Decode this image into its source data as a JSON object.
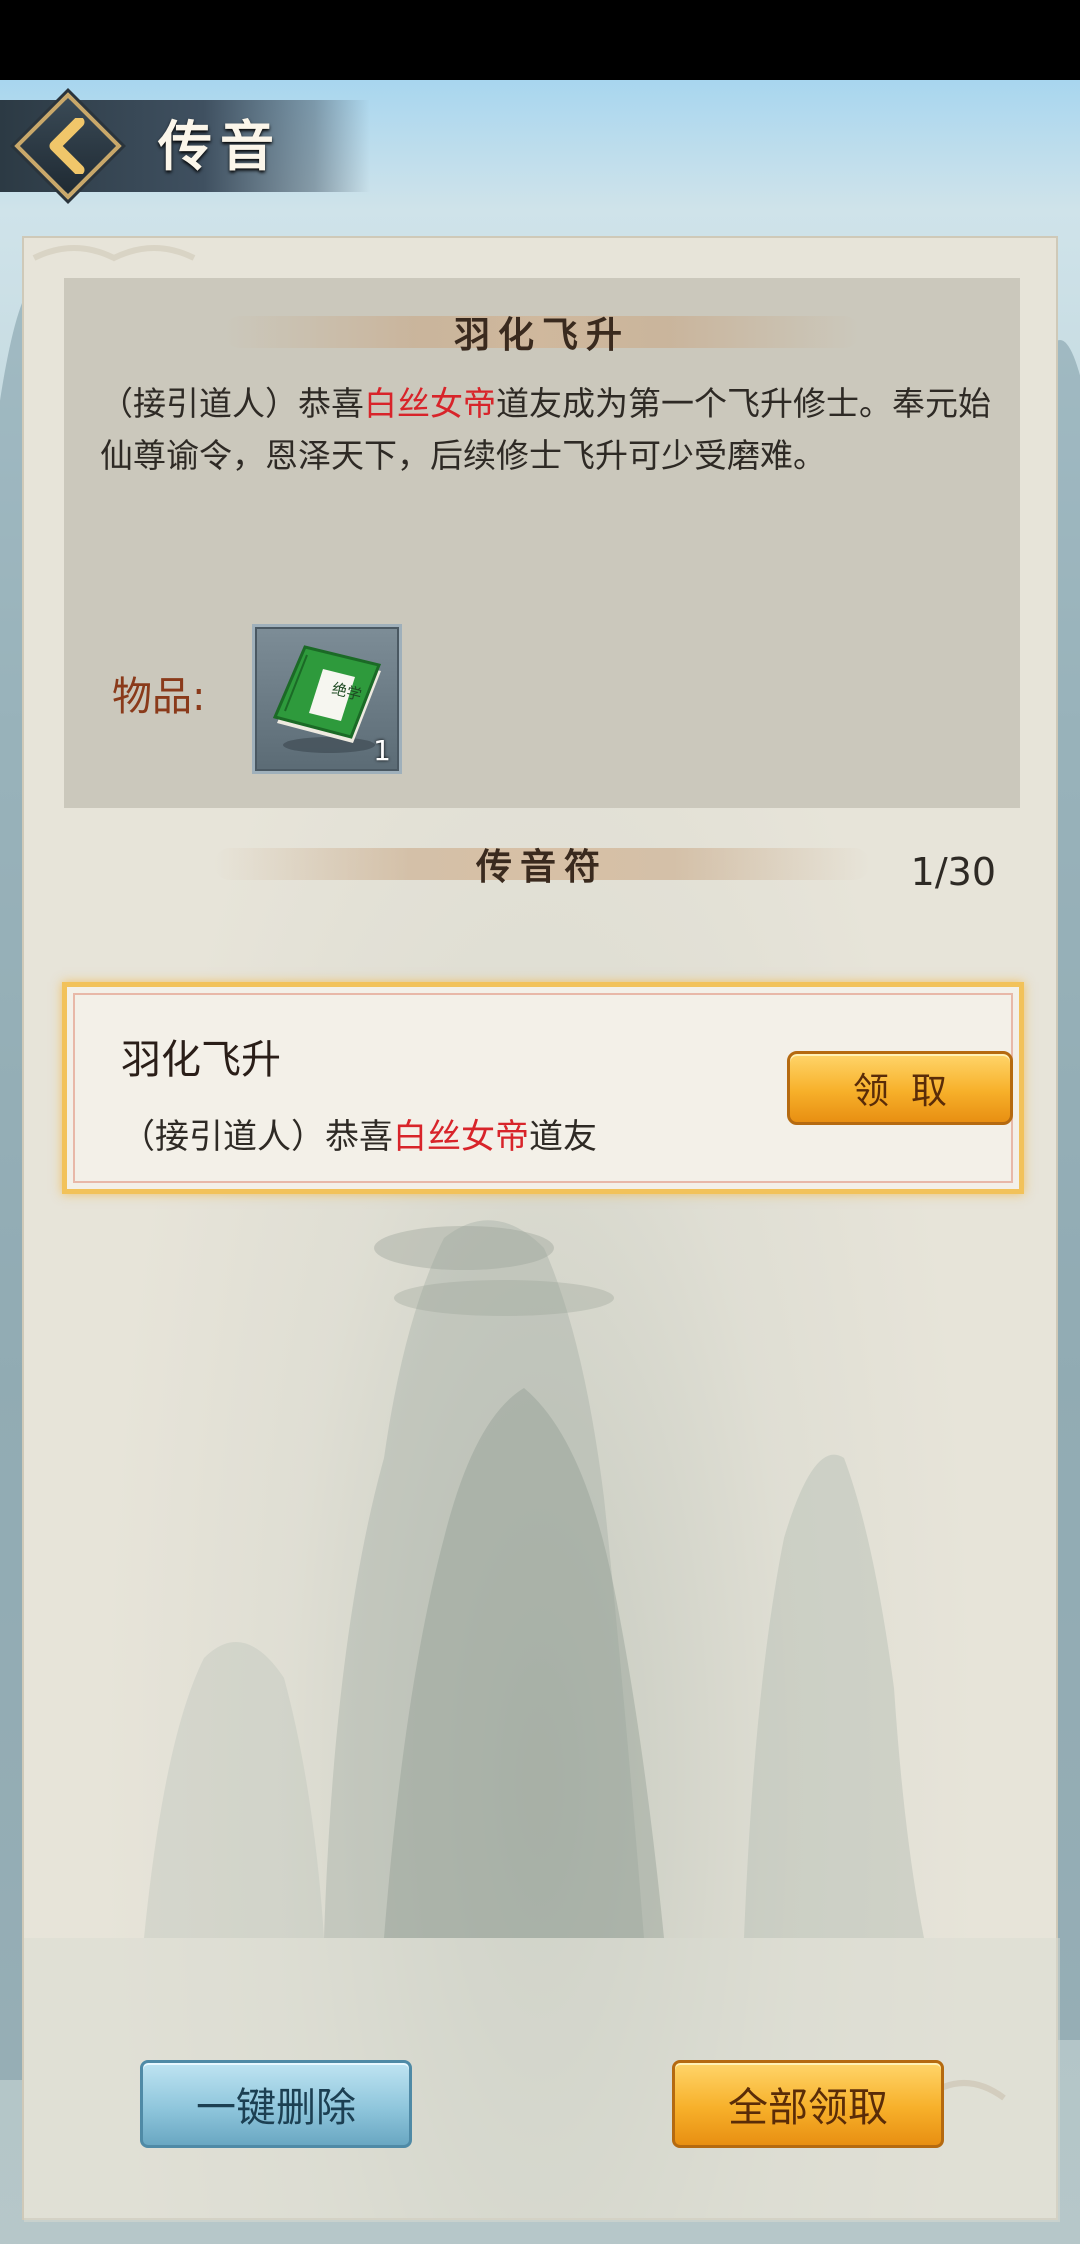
{
  "header": {
    "title": "传音",
    "back_icon": "chevron-left-icon"
  },
  "detail": {
    "title": "羽化飞升",
    "body_part1": "（接引道人）恭喜",
    "body_highlight": "白丝女帝",
    "body_part2": "道友成为第一个飞升修士。奉元始仙尊谕令，恩泽天下，后续修士飞升可少受磨难。",
    "items_label": "物品:",
    "item": {
      "icon": "green-book-icon",
      "book_text": "绝学",
      "count": "1"
    }
  },
  "list": {
    "title": "传音符",
    "count": "1/30",
    "mails": [
      {
        "title": "羽化飞升",
        "preview_part1": "（接引道人）恭喜",
        "preview_highlight": "白丝女帝",
        "preview_part2": "道友",
        "claim_label": "领取"
      }
    ]
  },
  "footer": {
    "delete_all_label": "一键删除",
    "claim_all_label": "全部领取"
  },
  "colors": {
    "highlight": "#d8242a",
    "gold_button": "#f7b02a",
    "blue_button": "#8fc6dc",
    "panel": "#e7e4d9"
  }
}
